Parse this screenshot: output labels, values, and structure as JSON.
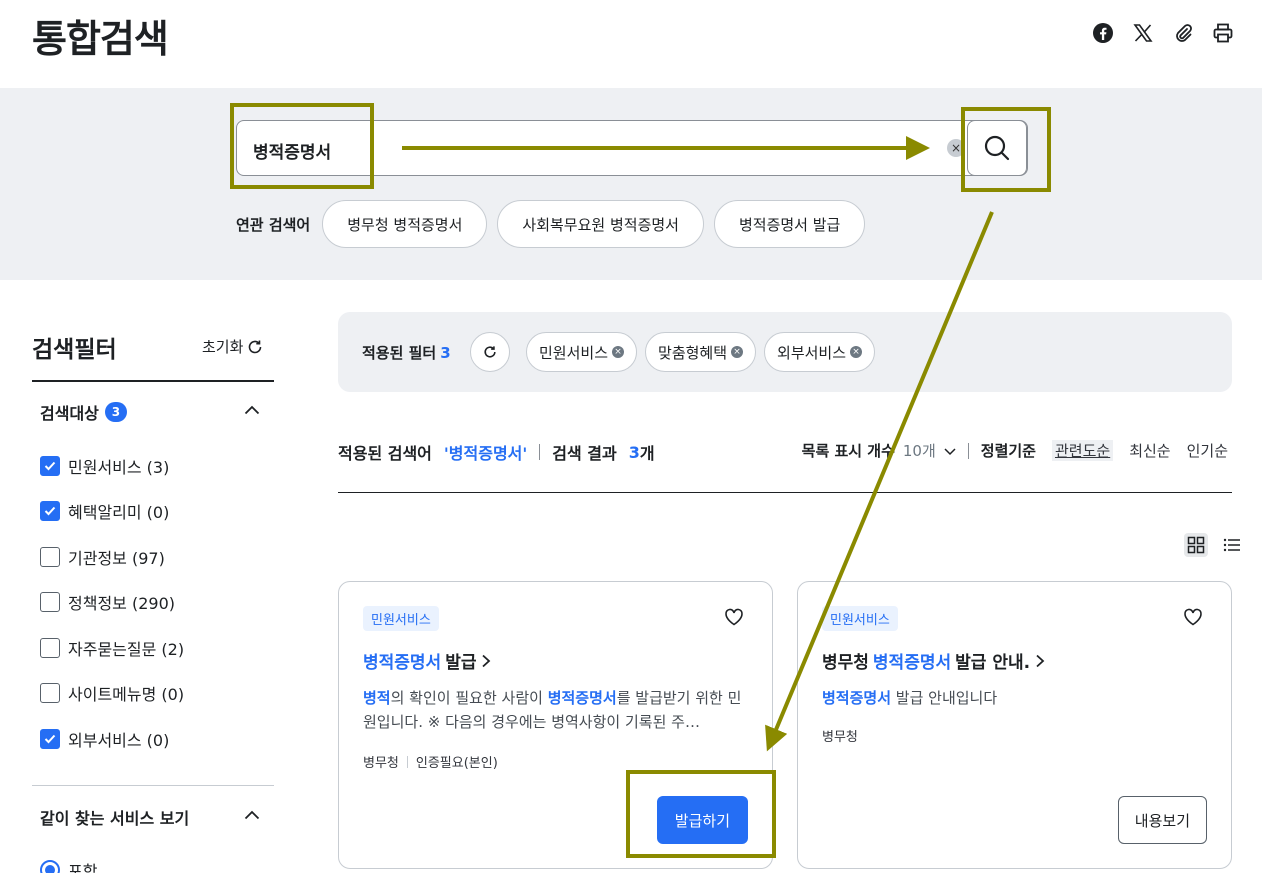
{
  "header": {
    "title": "통합검색",
    "icons": [
      "facebook-icon",
      "x-twitter-icon",
      "attach-icon",
      "print-icon"
    ]
  },
  "search": {
    "query": "병적증명서",
    "clear_symbol": "×",
    "search_icon": "magnifier-icon"
  },
  "related": {
    "label": "연관 검색어",
    "chips": [
      "병무청 병적증명서",
      "사회복무요원 병적증명서",
      "병적증명서 발급"
    ]
  },
  "filter": {
    "title": "검색필터",
    "reset_label": "초기화",
    "section1": {
      "title": "검색대상",
      "badge": "3",
      "items": [
        {
          "label": "민원서비스 (3)",
          "checked": true
        },
        {
          "label": "혜택알리미 (0)",
          "checked": true
        },
        {
          "label": "기관정보 (97)",
          "checked": false
        },
        {
          "label": "정책정보 (290)",
          "checked": false
        },
        {
          "label": "자주묻는질문 (2)",
          "checked": false
        },
        {
          "label": "사이트메뉴명 (0)",
          "checked": false
        },
        {
          "label": "외부서비스 (0)",
          "checked": true
        }
      ]
    },
    "section2": {
      "title": "같이 찾는 서비스 보기",
      "radio_label": "포함"
    }
  },
  "applied": {
    "label": "적용된 필터",
    "count": "3",
    "chips": [
      "민원서비스",
      "맞춤형혜택",
      "외부서비스"
    ]
  },
  "summary": {
    "keyword_label": "적용된 검색어",
    "keyword": "'병적증명서'",
    "result_label": "검색 결과",
    "result_count": "3",
    "result_unit": "개"
  },
  "sort": {
    "page_size_label": "목록 표시 개수",
    "page_size_value": "10개",
    "order_label": "정렬기준",
    "options": [
      "관련도순",
      "최신순",
      "인기순"
    ],
    "active": "관련도순"
  },
  "cards": [
    {
      "tag": "민원서비스",
      "title_hl": "병적증명서",
      "title_rest": "발급",
      "desc_parts": {
        "a_hl": "병적",
        "b": "의 확인이 필요한 사람이 ",
        "c_hl": "병적증명서",
        "d": "를 발급받기 위한 민원입니다. ※ 다음의 경우에는 병역사항이 기록된 주…"
      },
      "meta": [
        "병무청",
        "인증필요(본인)"
      ],
      "button": "발급하기"
    },
    {
      "tag": "민원서비스",
      "title_pre": "병무청 ",
      "title_hl": "병적증명서",
      "title_rest": "발급 안내.",
      "desc_hl": "병적증명서",
      "desc_rest": " 발급 안내입니다",
      "meta": [
        "병무청"
      ],
      "button": "내용보기"
    }
  ],
  "colors": {
    "accent": "#256ef4",
    "annotation": "#8a8a00",
    "band": "#eef0f3"
  }
}
